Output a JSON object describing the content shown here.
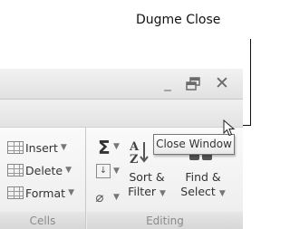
{
  "callout": {
    "label": "Dugme Close"
  },
  "window_controls": {
    "minimize_symbol": "_",
    "restore_symbol": "🗗",
    "close_symbol": "✕"
  },
  "document_controls": {
    "help_symbol": "?",
    "minimize_symbol": "–",
    "close_symbol": "✕"
  },
  "ribbon": {
    "cells_group": {
      "label": "Cells",
      "commands": [
        {
          "label": "Insert"
        },
        {
          "label": "Delete"
        },
        {
          "label": "Format"
        }
      ]
    },
    "editing_group": {
      "label": "Editing",
      "sum_symbol": "Σ",
      "sort_filter": {
        "line1": "Sort &",
        "line2": "Filter"
      },
      "find_select": {
        "line1": "Find &",
        "line2": "Select"
      }
    }
  },
  "tooltip": {
    "text": "Close Window"
  },
  "icons": [
    "help-icon",
    "minimize-icon",
    "restore-icon",
    "close-icon",
    "cursor-icon",
    "sum-icon",
    "fill-icon",
    "clear-icon",
    "sort-icon",
    "find-icon"
  ]
}
